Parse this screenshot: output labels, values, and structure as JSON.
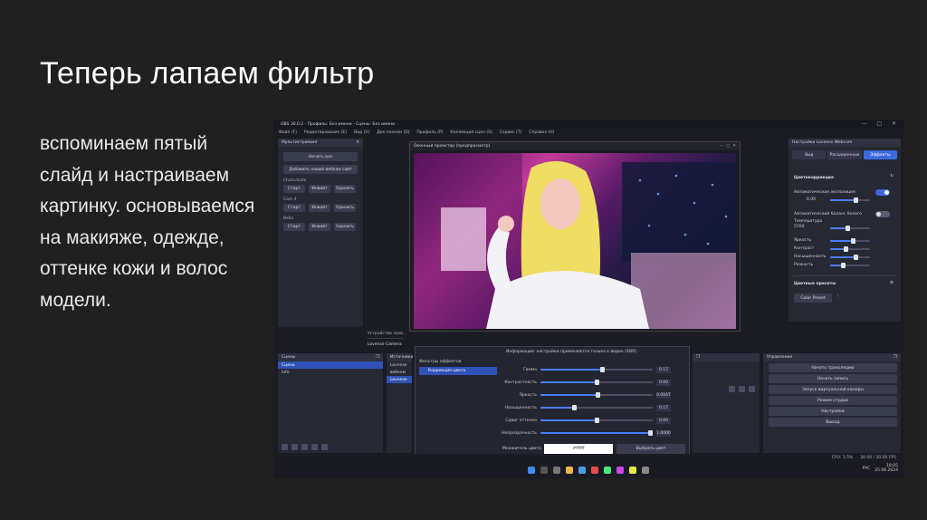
{
  "slide": {
    "title": "Теперь лапаем фильтр",
    "body": "вспоминаем пятый слайд и настраиваем картинку. основываемся на макияже, одежде, оттенке кожи и волос модели."
  },
  "screenshot": {
    "window_title": "OBS 30.0.2 - Профиль: Без имени - Сцены: Без имени",
    "menu": [
      "Файл (F)",
      "Редактирование (E)",
      "Вид (V)",
      "Док-панели (D)",
      "Профиль (P)",
      "Коллекция сцен (S)",
      "Сервис (T)",
      "Справка (H)"
    ],
    "left_panel": {
      "title": "Мультистриминг",
      "start_btn": "Начать все",
      "add_btn": "Добавить новый вебкам сайт",
      "sections": [
        {
          "label": "Chaturbate",
          "buttons": [
            "Старт",
            "Инвайт",
            "Удалить"
          ]
        },
        {
          "label": "Cam 4",
          "buttons": [
            "Старт",
            "Инвайт",
            "Удалить"
          ]
        },
        {
          "label": "Bella",
          "buttons": [
            "Старт",
            "Инвайт",
            "Удалить"
          ]
        }
      ]
    },
    "preview_title": "Оконный проектор (предпросмотр)",
    "source_status": "Устройство захв...",
    "source_name": "Lovense Camera",
    "properties": {
      "title": "Настройки Lovense Webcam",
      "tabs": [
        "Вид",
        "Расширенные",
        "Эффекты"
      ],
      "color_section": "Цветокоррекция",
      "auto_exposure": "Автоматическая экспозиция",
      "exposure_val": "0.00",
      "auto_wb": "Автоматический баланс белого",
      "temp_label": "Температура",
      "temp_val": "5700",
      "sliders": [
        "Яркость",
        "Контраст",
        "Насыщенность",
        "Резкость"
      ],
      "color_presets": "Цветные пресеты",
      "preset_btn": "Color Preset"
    },
    "scenes": {
      "title": "Сцены",
      "items": [
        "Сцена",
        "Info"
      ]
    },
    "sources": {
      "title": "Источники",
      "items": [
        "Lovense",
        "вебкам",
        "Lovense"
      ]
    },
    "filter_dialog": {
      "title": "Информация: настройки применяются только к видео (SDR)",
      "filters_title": "Фильтры эффектов",
      "filter_item": "Коррекция цвета",
      "rows": [
        {
          "label": "Гамма",
          "value": "0.17"
        },
        {
          "label": "Контрастность",
          "value": "0.00"
        },
        {
          "label": "Яркость",
          "value": "0.0047"
        },
        {
          "label": "Насыщенность",
          "value": "0.17"
        },
        {
          "label": "Сдвиг оттенка",
          "value": "0.00"
        },
        {
          "label": "Непрозрачность",
          "value": "1.0000"
        }
      ],
      "multiply_label": "Множитель цвета",
      "multiply_value": "#ffffff",
      "pick_btn": "Выбрать цвет"
    },
    "controls": {
      "title": "Управление",
      "buttons": [
        "Начать трансляцию",
        "Начать запись",
        "Запуск виртуальной камеры",
        "Режим студии",
        "Настройки",
        "Выход"
      ]
    },
    "status": {
      "cpu": "CPU: 1.5%",
      "fps": "30.00 / 30.00 FPS"
    },
    "tray": {
      "lang": "РУС",
      "time": "18:05",
      "date": "25.06.2024"
    },
    "colors": {
      "accent": "#3d6ae0",
      "toggle_on": "#3d6ae0"
    }
  }
}
